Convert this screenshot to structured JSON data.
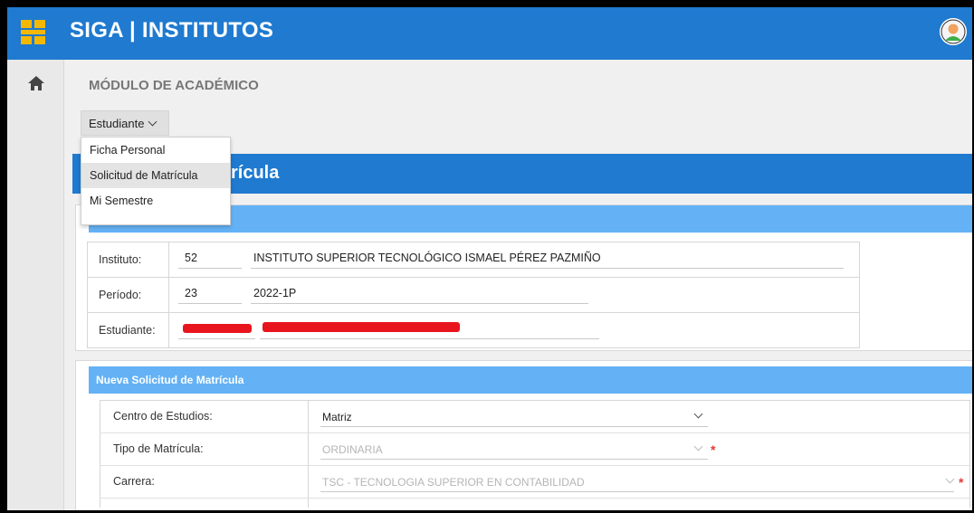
{
  "app": {
    "title": "SIGA | INSTITUTOS"
  },
  "module": {
    "title": "MÓDULO DE ACADÉMICO"
  },
  "menu": {
    "button_label": "Estudiante",
    "items": [
      {
        "label": "Ficha Personal",
        "active": false
      },
      {
        "label": "Solicitud de Matrícula",
        "active": true
      },
      {
        "label": "Mi Semestre",
        "active": false
      }
    ]
  },
  "page": {
    "header_visible": "rícula"
  },
  "info": {
    "instituto_label": "Instituto:",
    "instituto_code": "52",
    "instituto_name": "INSTITUTO SUPERIOR TECNOLÓGICO ISMAEL PÉREZ PAZMIÑO",
    "periodo_label": "Período:",
    "periodo_code": "23",
    "periodo_name": "2022-1P",
    "estudiante_label": "Estudiante:"
  },
  "form": {
    "section_title": "Nueva Solicitud de Matrícula",
    "rows": [
      {
        "label": "Centro de Estudios:",
        "value": "Matriz",
        "enabled": true,
        "required": false
      },
      {
        "label": "Tipo de Matrícula:",
        "value": "ORDINARIA",
        "enabled": false,
        "required": true
      },
      {
        "label": "Carrera:",
        "value": "TSC - TECNOLOGIA SUPERIOR EN CONTABILIDAD",
        "enabled": false,
        "required": true
      }
    ]
  },
  "colors": {
    "topbar": "#1f7ad0",
    "section_header": "#64b2f5",
    "redaction": "#e8151e",
    "required": "#e53935"
  },
  "icons": [
    "app-logo-icon",
    "user-avatar-icon",
    "home-icon",
    "chevron-down-icon"
  ]
}
